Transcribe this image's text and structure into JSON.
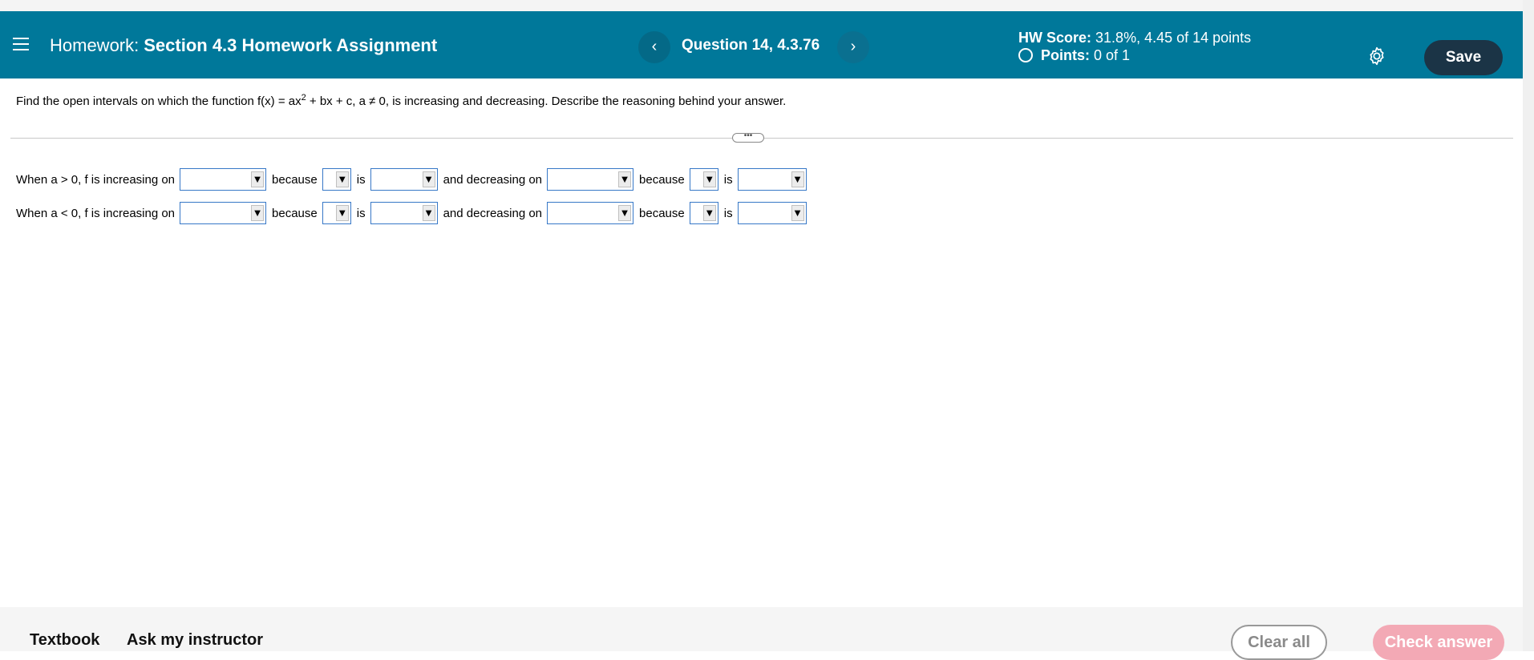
{
  "header": {
    "title_lead": "Homework:",
    "title_section": "Section 4.3 Homework Assignment",
    "question_label": "Question 14, 4.3.76",
    "prev_glyph": "‹",
    "next_glyph": "›",
    "score_label": "HW Score:",
    "score_value": "31.8%, 4.45 of 14 points",
    "points_label": "Points:",
    "points_value": "0 of 1",
    "save_label": "Save"
  },
  "question": {
    "prompt_pre": "Find the open intervals on which the function f(x) = ax",
    "prompt_exp": "2",
    "prompt_post": " + bx + c, a ≠ 0, is increasing and decreasing. Describe the reasoning behind your answer.",
    "divider_handle": "•••"
  },
  "rows": [
    {
      "lead": "When a > 0, f is increasing on",
      "because": "because",
      "is": "is",
      "and_decreasing": "and decreasing on"
    },
    {
      "lead": "When a < 0, f is increasing on",
      "because": "because",
      "is": "is",
      "and_decreasing": "and decreasing on"
    }
  ],
  "dropdown_glyph": "▼",
  "footer": {
    "textbook": "Textbook",
    "ask_instructor": "Ask my instructor",
    "clear_all": "Clear all",
    "check_answer": "Check answer"
  },
  "colors": {
    "header_bg": "#00789a",
    "save_bg": "#1b3446",
    "check_bg": "#f3a9b5",
    "dropdown_border": "#3778c7"
  },
  "icons": {
    "menu": "hamburger-menu-icon",
    "settings": "gear-icon",
    "points_status": "empty-circle-icon"
  }
}
